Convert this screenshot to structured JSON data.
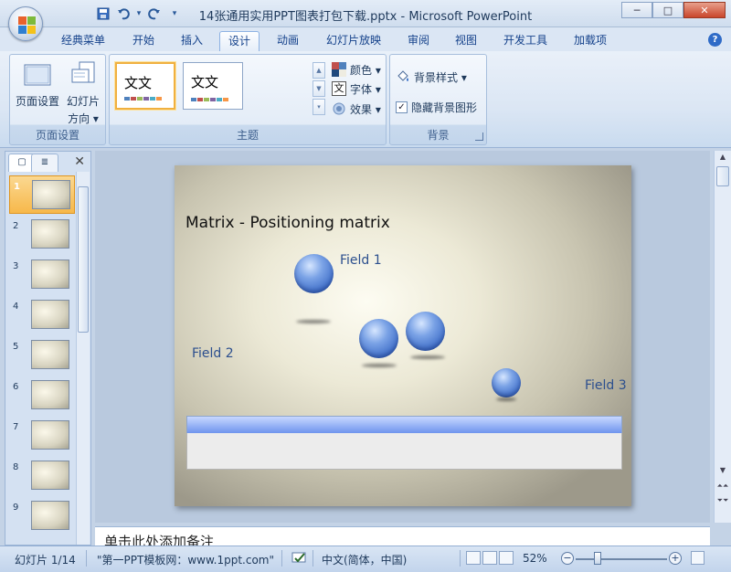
{
  "window": {
    "title": "14张通用实用PPT图表打包下载.pptx - Microsoft PowerPoint",
    "controls": {
      "minimize": "─",
      "maximize": "□",
      "close": "✕"
    }
  },
  "quick_access": {
    "save": "save-icon",
    "undo": "undo-icon",
    "redo": "redo-icon",
    "customize": "▾"
  },
  "ribbon_tabs": [
    "经典菜单",
    "开始",
    "插入",
    "设计",
    "动画",
    "幻灯片放映",
    "审阅",
    "视图",
    "开发工具",
    "加载项"
  ],
  "active_tab": "设计",
  "groups": {
    "page_setup": {
      "label": "页面设置",
      "page_setup_btn": "页面设置",
      "orientation_btn_line1": "幻灯片",
      "orientation_btn_line2": "方向 ▾"
    },
    "themes": {
      "label": "主题",
      "theme1": "文文",
      "theme2": "文文",
      "colors": "颜色 ▾",
      "fonts": "字体 ▾",
      "effects": "效果 ▾"
    },
    "background": {
      "label": "背景",
      "styles": "背景样式 ▾",
      "hide_graphics": "隐藏背景图形",
      "hide_graphics_checked": true
    }
  },
  "slides_panel": {
    "tab_slides": "▢",
    "tab_outline": "≣",
    "close": "✕",
    "slide_numbers": [
      "1",
      "2",
      "3",
      "4",
      "5",
      "6",
      "7",
      "8",
      "9"
    ],
    "active_slide": 1
  },
  "slide": {
    "title": "Matrix - Positioning matrix",
    "field1": "Field 1",
    "field2": "Field 2",
    "field3": "Field 3"
  },
  "notes": {
    "placeholder": "单击此处添加备注"
  },
  "status": {
    "slide_info": "幻灯片 1/14",
    "theme_name": "\"第一PPT模板网：www.1ppt.com\"",
    "language": "中文(简体，中国)",
    "zoom": "52%",
    "zoom_minus": "−",
    "zoom_plus": "+"
  },
  "colors": {
    "accent_blue": "#2c4f8e",
    "active_orange": "#f7b84a"
  }
}
